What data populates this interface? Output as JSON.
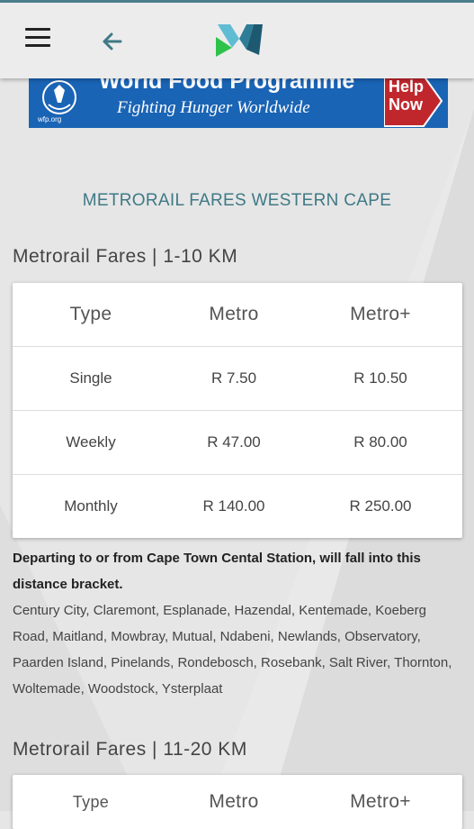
{
  "app": {
    "menu_icon": "menu-icon",
    "back_icon": "arrow-back-icon",
    "logo": "app-logo"
  },
  "banner": {
    "title": "World Food Programme",
    "subtitle": "Fighting Hunger Worldwide",
    "small": "wfp.org",
    "help_line1": "Help",
    "help_line2": "Now"
  },
  "page": {
    "heading": "METRORAIL FARES WESTERN CAPE"
  },
  "sections": [
    {
      "title": "Metrorail Fares | 1-10 KM",
      "headers": [
        "Type",
        "Metro",
        "Metro+"
      ],
      "rows": [
        [
          "Single",
          "R 7.50",
          "R 10.50"
        ],
        [
          "Weekly",
          "R 47.00",
          "R 80.00"
        ],
        [
          "Monthly",
          "R 140.00",
          "R 250.00"
        ]
      ],
      "note_bold": "Departing to or from Cape Town Cental Station, will fall into this distance bracket.",
      "note_text": "Century City, Claremont, Esplanade, Hazendal, Kentemade, Koeberg Road, Maitland, Mowbray, Mutual, Ndabeni, Newlands, Observatory, Paarden Island, Pinelands, Rondebosch, Rosebank, Salt River, Thornton, Woltemade, Woodstock, Ysterplaat"
    },
    {
      "title": "Metrorail Fares | 11-20 KM",
      "headers": [
        "Type",
        "Metro",
        "Metro+"
      ]
    }
  ],
  "colors": {
    "accent": "#3f7985",
    "banner_blue": "#1a64b5",
    "help_red": "#c0272d"
  }
}
